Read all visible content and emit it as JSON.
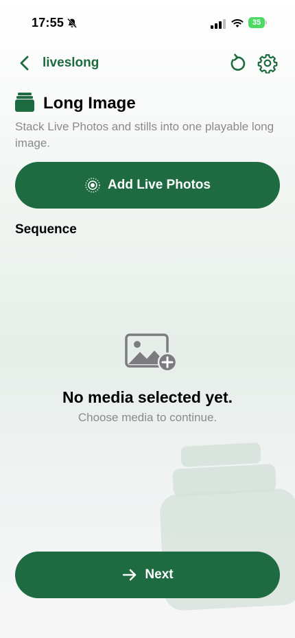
{
  "status_bar": {
    "time": "17:55",
    "battery_level": "35"
  },
  "nav": {
    "title": "liveslong"
  },
  "header": {
    "title": "Long Image",
    "subtitle": "Stack Live Photos and stills into one playable long image."
  },
  "actions": {
    "add_label": "Add Live Photos",
    "next_label": "Next"
  },
  "sequence": {
    "label": "Sequence"
  },
  "empty_state": {
    "title": "No media selected yet.",
    "subtitle": "Choose media to continue."
  },
  "colors": {
    "accent": "#1f6b41",
    "nav_tint": "#1d6a3e",
    "secondary_text": "#8a8a8e"
  },
  "icons": {
    "back": "chevron-left-icon",
    "reset": "reset-icon",
    "settings": "gear-icon",
    "header": "stack-icon",
    "add": "live-photo-icon",
    "empty": "add-photo-icon",
    "next": "arrow-right-icon"
  }
}
